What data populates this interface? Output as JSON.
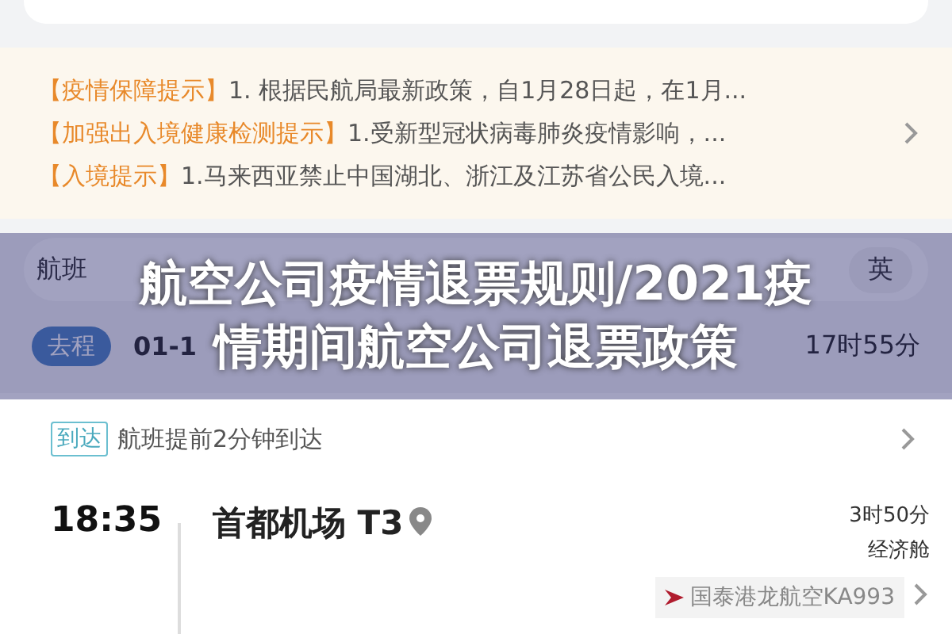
{
  "notices": [
    {
      "tag": "【疫情保障提示】",
      "text": "1. 根据民航局最新政策，自1月28日起，在1月..."
    },
    {
      "tag": "【加强出入境健康检测提示】",
      "text": "1.受新型冠状病毒肺炎疫情影响，..."
    },
    {
      "tag": "【入境提示】",
      "text": "1.马来西亚禁止中国湖北、浙江及江苏省公民入境..."
    }
  ],
  "flight_bar": {
    "label": "航班",
    "language": "英"
  },
  "trip": {
    "tag": "去程",
    "date": "01-1",
    "duration": "17时55分"
  },
  "arrival": {
    "tag": "到达",
    "text": "航班提前2分钟到达"
  },
  "segment": {
    "time": "18:35",
    "airport": "首都机场 T3",
    "duration": "3时50分",
    "cabin": "经济舱",
    "airline": "国泰港龙航空KA993"
  },
  "overlay_title": [
    "航空公司疫情退票规则/2021疫",
    "情期间航空公司退票政策"
  ]
}
